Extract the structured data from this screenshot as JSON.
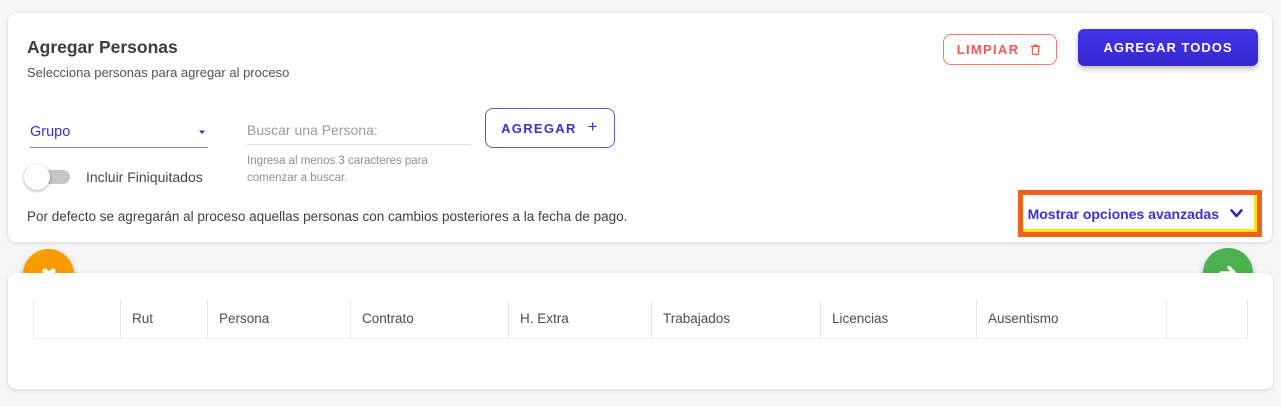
{
  "panel": {
    "title": "Agregar Personas",
    "subtitle": "Selecciona personas para agregar al proceso",
    "clear_label": "LIMPIAR",
    "add_all_label": "AGREGAR TODOS",
    "note": "Por defecto se agregarán al proceso aquellas personas con cambios posteriores a la fecha de pago.",
    "advanced_label": "Mostrar opciones avanzadas"
  },
  "filters": {
    "group_value": "Grupo",
    "search_placeholder": "Buscar una Persona:",
    "search_helper": "Ingresa al menos 3 caracteres para comenzar a buscar.",
    "add_label": "AGREGAR",
    "add_plus": "+",
    "toggle_label": "Incluir Finiquitados",
    "toggle_state": "off"
  },
  "table": {
    "columns": [
      "",
      "Rut",
      "Persona",
      "Contrato",
      "H. Extra",
      "Trabajados",
      "Licencias",
      "Ausentismo",
      ""
    ]
  },
  "colors": {
    "primary_indigo": "#3a30d4",
    "danger_red": "#f2584d",
    "highlight_orange": "#f1611e",
    "highlight_yellow": "#ffe317",
    "fab_close_orange": "#f89b00",
    "fab_next_green": "#4caf50"
  }
}
